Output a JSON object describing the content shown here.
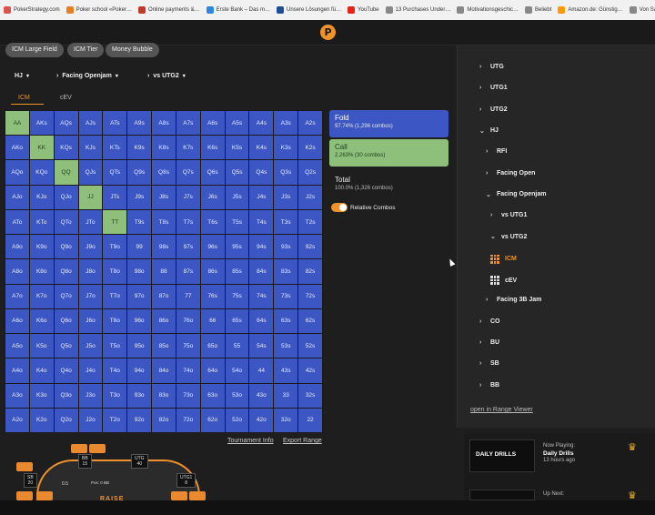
{
  "bookmarks": [
    {
      "label": "PokerStrategy.com",
      "color": "#d9534f"
    },
    {
      "label": "Poker school «Poker…",
      "color": "#e67e22"
    },
    {
      "label": "Online payments &…",
      "color": "#c0392b"
    },
    {
      "label": "Erste Bank – Das m…",
      "color": "#2e86de"
    },
    {
      "label": "Unsere Lösungen fü…",
      "color": "#1f4e99"
    },
    {
      "label": "YouTube",
      "color": "#e62117"
    },
    {
      "label": "13 Purchases Under…",
      "color": "#888888"
    },
    {
      "label": "Motivationsgeschic…",
      "color": "#888888"
    },
    {
      "label": "Beliebt",
      "color": "#888888"
    },
    {
      "label": "Amazon.de: Günstig…",
      "color": "#ff9900"
    },
    {
      "label": "Von Safari importiert",
      "color": "#888888"
    }
  ],
  "app": {
    "logo": "P"
  },
  "chips": [
    "ICM Large Field",
    "ICM Tier",
    "Money Bubble"
  ],
  "selectors": {
    "position": "HJ",
    "action": "Facing Openjam",
    "vs": "vs UTG2"
  },
  "tabs": {
    "icm": "ICM",
    "cev": "cEV"
  },
  "grid": {
    "hands": [
      [
        "AA",
        "AKs",
        "AQs",
        "AJs",
        "ATs",
        "A9s",
        "A8s",
        "A7s",
        "A6s",
        "A5s",
        "A4s",
        "A3s",
        "A2s"
      ],
      [
        "AKo",
        "KK",
        "KQs",
        "KJs",
        "KTs",
        "K9s",
        "K8s",
        "K7s",
        "K6s",
        "K5s",
        "K4s",
        "K3s",
        "K2s"
      ],
      [
        "AQo",
        "KQo",
        "QQ",
        "QJs",
        "QTs",
        "Q9s",
        "Q8s",
        "Q7s",
        "Q6s",
        "Q5s",
        "Q4s",
        "Q3s",
        "Q2s"
      ],
      [
        "AJo",
        "KJo",
        "QJo",
        "JJ",
        "JTs",
        "J9s",
        "J8s",
        "J7s",
        "J6s",
        "J5s",
        "J4s",
        "J3s",
        "J2s"
      ],
      [
        "ATo",
        "KTo",
        "QTo",
        "JTo",
        "TT",
        "T9s",
        "T8s",
        "T7s",
        "T6s",
        "T5s",
        "T4s",
        "T3s",
        "T2s"
      ],
      [
        "A9o",
        "K9o",
        "Q9o",
        "J9o",
        "T9o",
        "99",
        "98s",
        "97s",
        "96s",
        "95s",
        "94s",
        "93s",
        "92s"
      ],
      [
        "A8o",
        "K8o",
        "Q8o",
        "J8o",
        "T8o",
        "98o",
        "88",
        "87s",
        "86s",
        "85s",
        "84s",
        "83s",
        "82s"
      ],
      [
        "A7o",
        "K7o",
        "Q7o",
        "J7o",
        "T7o",
        "97o",
        "87o",
        "77",
        "76s",
        "75s",
        "74s",
        "73s",
        "72s"
      ],
      [
        "A6o",
        "K6o",
        "Q6o",
        "J6o",
        "T6o",
        "96o",
        "86o",
        "76o",
        "66",
        "65s",
        "64s",
        "63s",
        "62s"
      ],
      [
        "A5o",
        "K5o",
        "Q5o",
        "J5o",
        "T5o",
        "95o",
        "85o",
        "75o",
        "65o",
        "55",
        "54s",
        "53s",
        "52s"
      ],
      [
        "A4o",
        "K4o",
        "Q4o",
        "J4o",
        "T4o",
        "94o",
        "84o",
        "74o",
        "64o",
        "54o",
        "44",
        "43s",
        "42s"
      ],
      [
        "A3o",
        "K3o",
        "Q3o",
        "J3o",
        "T3o",
        "93o",
        "83o",
        "73o",
        "63o",
        "53o",
        "43o",
        "33",
        "32s"
      ],
      [
        "A2o",
        "K2o",
        "Q2o",
        "J2o",
        "T2o",
        "92o",
        "82o",
        "72o",
        "62o",
        "52o",
        "42o",
        "32o",
        "22"
      ]
    ],
    "call_hands": [
      "AA",
      "KK",
      "QQ",
      "JJ",
      "TT"
    ],
    "colors": {
      "fold": "#3c57c4",
      "call": "#8ec07c"
    }
  },
  "links": {
    "tournament_info": "Tournament Info",
    "export_range": "Export Range",
    "open_range_viewer": "open in Range Viewer"
  },
  "legend": {
    "fold": {
      "label": "Fold",
      "detail": "97.74% (1,296 combos)"
    },
    "call": {
      "label": "Call",
      "detail": "2.263% (30 combos)"
    },
    "total": {
      "label": "Total",
      "detail": "100.0% (1,326 combos)"
    },
    "toggle": {
      "label": "Relative Combos",
      "on": true
    }
  },
  "table": {
    "seats": [
      {
        "name": "SB",
        "stack": "20"
      },
      {
        "name": "BB",
        "stack": "15"
      },
      {
        "name": "UTG",
        "stack": "40"
      },
      {
        "name": "UTG1",
        "stack": "8"
      }
    ],
    "pot_label": "0.5",
    "pot_info": "Pos: 0 BB",
    "brand": "RAISE"
  },
  "sidebar": {
    "items": [
      {
        "label": "UTG",
        "chev": "›",
        "level": 0
      },
      {
        "label": "UTG1",
        "chev": "›",
        "level": 0
      },
      {
        "label": "UTG2",
        "chev": "›",
        "level": 0
      },
      {
        "label": "HJ",
        "chev": "⌄",
        "level": 0
      },
      {
        "label": "RFI",
        "chev": "›",
        "level": 1
      },
      {
        "label": "Facing Open",
        "chev": "›",
        "level": 1
      },
      {
        "label": "Facing Openjam",
        "chev": "⌄",
        "level": 1
      },
      {
        "label": "vs UTG1",
        "chev": "›",
        "level": 2
      },
      {
        "label": "vs UTG2",
        "chev": "⌄",
        "level": 2
      },
      {
        "label": "ICM",
        "icon": "grid-icon",
        "level": 3,
        "active": true
      },
      {
        "label": "cEV",
        "icon": "grid-icon",
        "level": 3
      },
      {
        "label": "Facing 3B Jam",
        "chev": "›",
        "level": 1
      },
      {
        "label": "CO",
        "chev": "›",
        "level": 0
      },
      {
        "label": "BU",
        "chev": "›",
        "level": 0
      },
      {
        "label": "SB",
        "chev": "›",
        "level": 0
      },
      {
        "label": "BB",
        "chev": "›",
        "level": 0
      }
    ]
  },
  "video": {
    "now_playing_label": "Now Playing:",
    "now_playing_title": "Daily Drills",
    "now_playing_time": "13 hours ago",
    "thumb_title": "DAILY DRILLS",
    "up_next_label": "Up Next:"
  }
}
